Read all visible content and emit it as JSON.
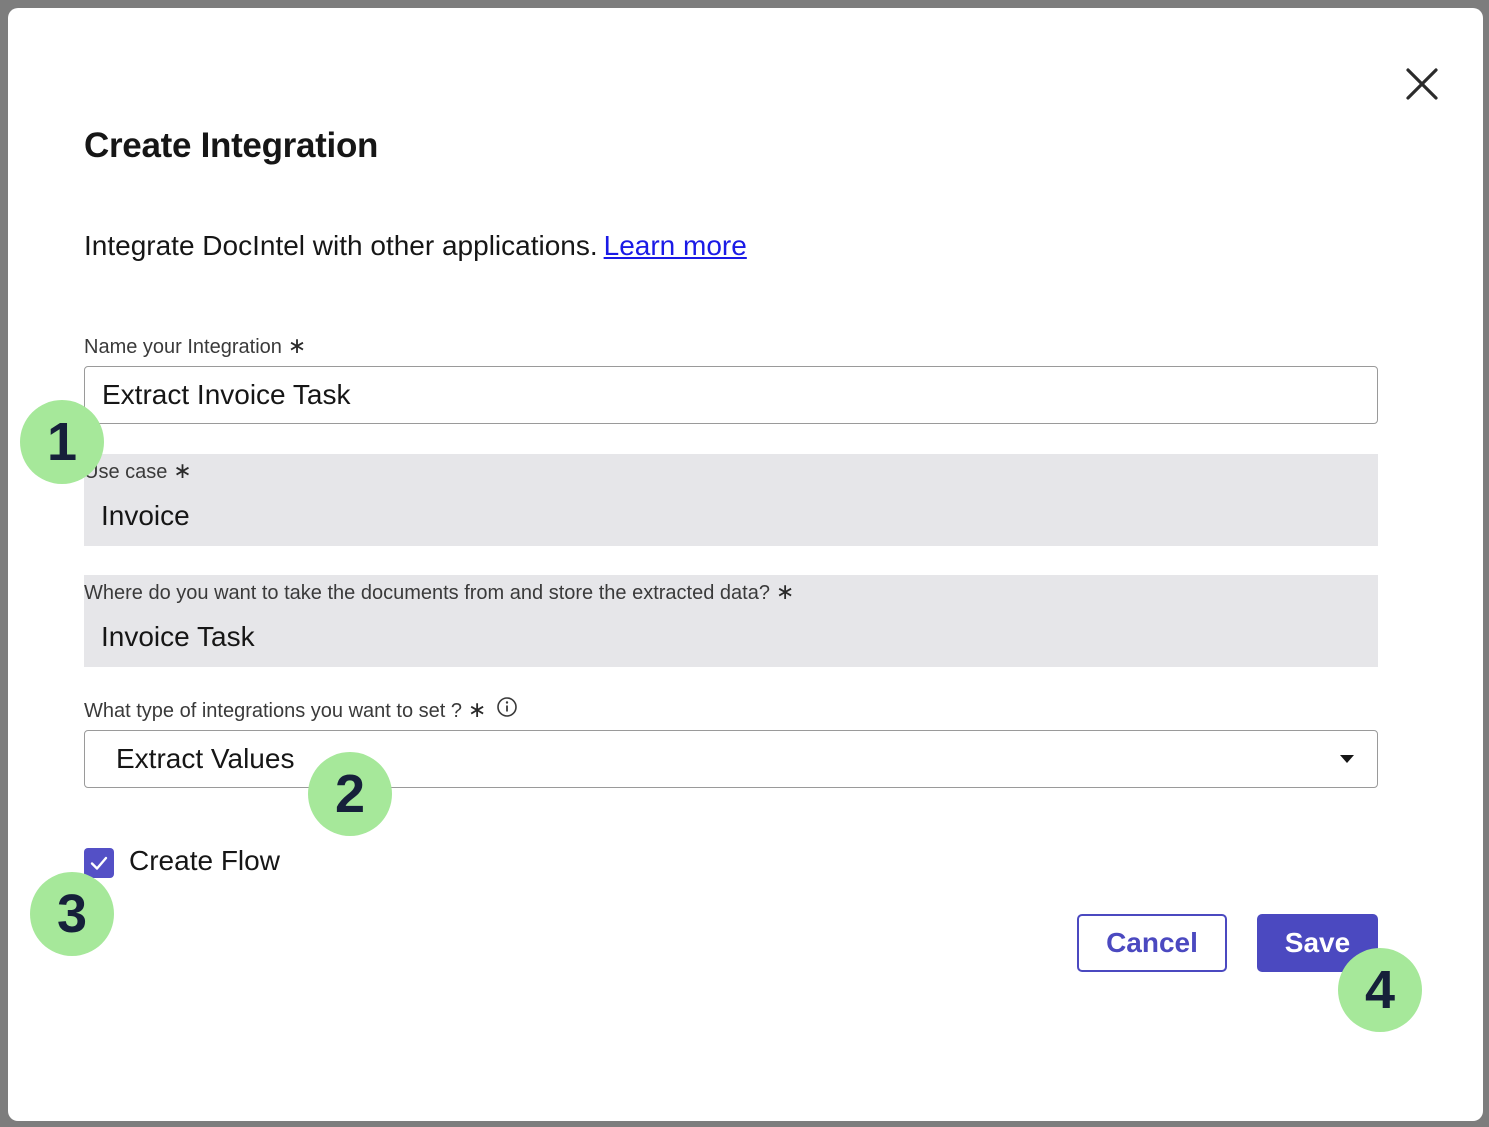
{
  "dialog": {
    "title": "Create Integration",
    "intro_text": "Integrate DocIntel with other applications.",
    "learn_more_link": "Learn more",
    "close_icon": "close-icon"
  },
  "fields": {
    "name": {
      "label": "Name your Integration",
      "required_marker": "∗",
      "value": "Extract Invoice Task"
    },
    "use_case": {
      "label": "Use case",
      "required_marker": "∗",
      "value": "Invoice"
    },
    "source": {
      "label": "Where do you want to take the documents from and store the extracted data?",
      "required_marker": "∗",
      "value": "Invoice Task"
    },
    "integration_type": {
      "label": "What type of integrations you want to set ?",
      "required_marker": "∗",
      "info_icon": "info-icon",
      "selected": "Extract Values",
      "caret_icon": "caret-down-icon"
    }
  },
  "create_flow": {
    "label": "Create Flow",
    "checked": true
  },
  "actions": {
    "cancel_label": "Cancel",
    "save_label": "Save"
  },
  "callouts": [
    "1",
    "2",
    "3",
    "4"
  ],
  "colors": {
    "primary": "#4b49c0",
    "checkbox": "#5450c6",
    "link": "#1a1ae6",
    "readonly_bg": "#e6e6e9",
    "callout_bg": "#a6e89a",
    "callout_text": "#16203a"
  }
}
